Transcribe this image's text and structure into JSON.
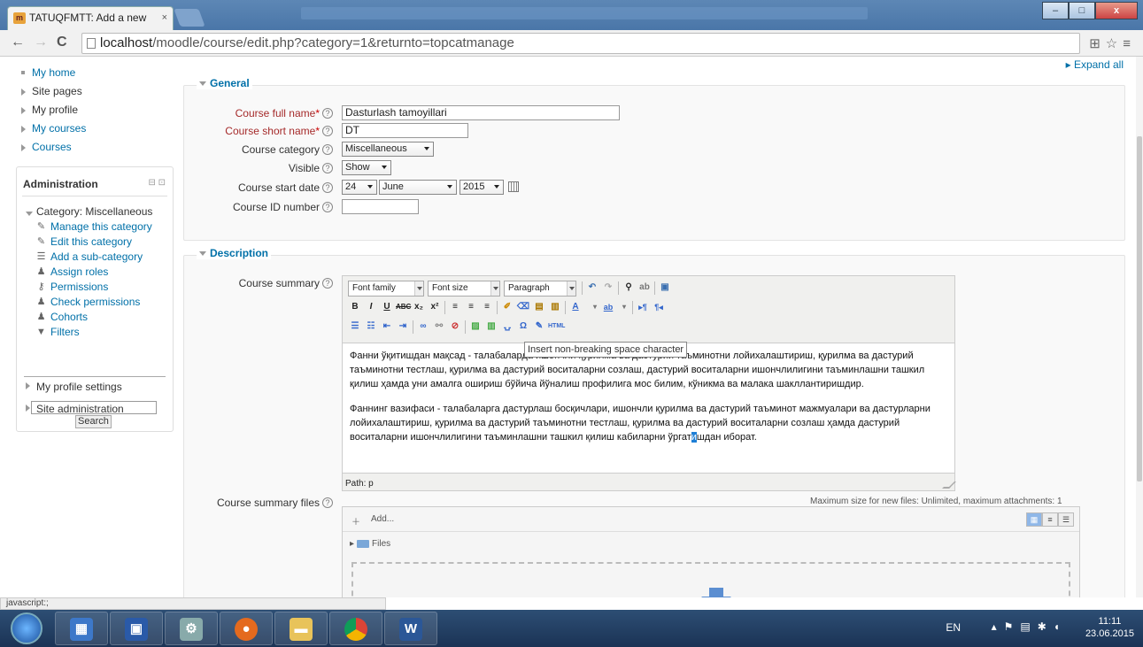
{
  "browser": {
    "tab_title": "TATUQFMTT: Add a new",
    "tab_close": "×",
    "url_host": "localhost",
    "url_path": "/moodle/course/edit.php?category=1&returnto=topcatmanage",
    "back_icon": "back-arrow-icon",
    "forward_icon": "forward-arrow-icon",
    "reload_icon": "reload-icon"
  },
  "window": {
    "minimize": "–",
    "maximize": "□",
    "close": "x"
  },
  "nav": {
    "items": [
      {
        "label": "My home"
      },
      {
        "label": "Site pages"
      },
      {
        "label": "My profile"
      },
      {
        "label": "My courses"
      },
      {
        "label": "Courses"
      }
    ]
  },
  "admin": {
    "title": "Administration",
    "category": "Category: Miscellaneous",
    "items": [
      {
        "label": "Manage this category",
        "icon": "pencil-icon"
      },
      {
        "label": "Edit this category",
        "icon": "pencil-icon"
      },
      {
        "label": "Add a sub-category",
        "icon": "list-icon"
      },
      {
        "label": "Assign roles",
        "icon": "user-icon"
      },
      {
        "label": "Permissions",
        "icon": "key-icon"
      },
      {
        "label": "Check permissions",
        "icon": "user-icon"
      },
      {
        "label": "Cohorts",
        "icon": "users-icon"
      },
      {
        "label": "Filters",
        "icon": "funnel-icon"
      }
    ],
    "profile_settings": "My profile settings",
    "site_admin": "Site administration",
    "search_button": "Search"
  },
  "expand_all": "Expand all",
  "general": {
    "legend": "General",
    "full_name_label": "Course full name",
    "full_name_value": "Dasturlash tamoyillari",
    "short_name_label": "Course short name",
    "short_name_value": "DT",
    "category_label": "Course category",
    "category_value": "Miscellaneous",
    "visible_label": "Visible",
    "visible_value": "Show",
    "start_date_label": "Course start date",
    "start_day": "24",
    "start_month": "June",
    "start_year": "2015",
    "id_label": "Course ID number",
    "id_value": ""
  },
  "description": {
    "legend": "Description",
    "summary_label": "Course summary",
    "font_family": "Font family",
    "font_size": "Font size",
    "paragraph": "Paragraph",
    "tooltip": "Insert non-breaking space character",
    "para1": "Фанни ўқитишдан мақсад - талабаларда ишончли қурилма ва дастурий таъминотни лойихалаштириш, қурилма ва дастурий таъминотни тестлаш, қурилма ва дастурий воситаларни созлаш, дастурий воситаларни ишончлилигини таъминлашни ташкил қилиш ҳамда уни амалга ошириш бўйича йўналиш профилига мос билим, кўникма ва малака шакллантиришдир.",
    "para2_before": "Фаннинг вазифаси - талабаларга дастурлаш босқичлари, ишончли қурилма ва дастурий таъминот мажмуалари ва дастурларни лойихалаштириш, қурилма ва дастурий таъминотни тестлаш, қурилма ва дастурий воситаларни созлаш ҳамда дастурий воситаларни ишончлилигини таъминлашни ташкил қилиш кабиларни ўргат",
    "para2_caret": "и",
    "para2_after": "шдан иборат.",
    "path": "Path: p",
    "files_label": "Course summary files",
    "max_size": "Maximum size for new files: Unlimited, maximum attachments: 1",
    "add": "Add...",
    "files": "Files"
  },
  "status_text": "javascript:;",
  "taskbar": {
    "lang": "EN",
    "time": "11:11",
    "date": "23.06.2015"
  }
}
